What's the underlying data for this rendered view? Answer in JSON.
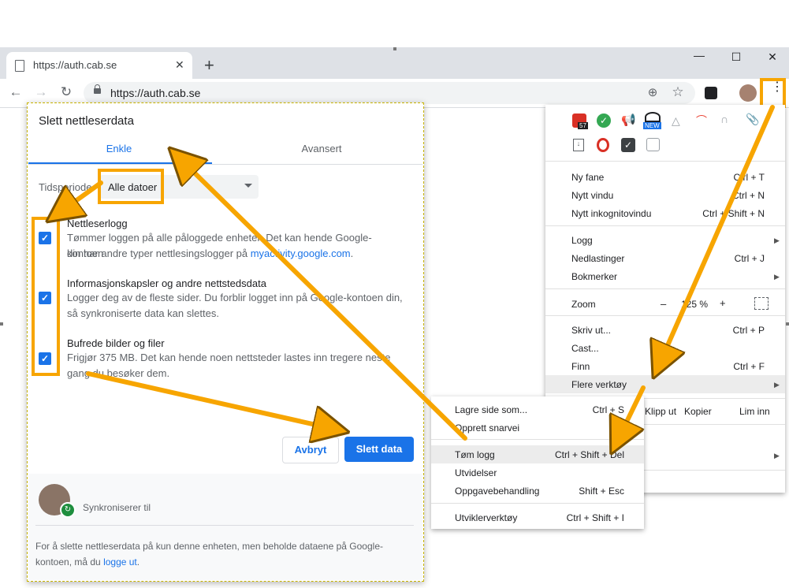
{
  "browser": {
    "tab_title": "https://auth.cab.se",
    "new_tab": "+",
    "url": "https://auth.cab.se",
    "win_min": "—",
    "win_max": "☐",
    "win_close": "✕"
  },
  "menu": {
    "ext_badge_count": "57",
    "ext_badge_new": "NEW",
    "items": [
      {
        "label": "Ny fane",
        "shortcut": "Ctrl + T"
      },
      {
        "label": "Nytt vindu",
        "shortcut": "Ctrl + N"
      },
      {
        "label": "Nytt inkognitovindu",
        "shortcut": "Ctrl + Shift + N"
      },
      {
        "label": "Logg",
        "shortcut": ""
      },
      {
        "label": "Nedlastinger",
        "shortcut": "Ctrl + J"
      },
      {
        "label": "Bokmerker",
        "shortcut": ""
      },
      {
        "label": "Zoom",
        "shortcut": ""
      },
      {
        "label": "Skriv ut...",
        "shortcut": "Ctrl + P"
      },
      {
        "label": "Cast...",
        "shortcut": ""
      },
      {
        "label": "Finn",
        "shortcut": "Ctrl + F"
      },
      {
        "label": "Flere verktøy",
        "shortcut": ""
      }
    ],
    "zoom_minus": "–",
    "zoom_value": "125 %",
    "zoom_plus": "+",
    "edit_cut": "Klipp ut",
    "edit_copy": "Kopier",
    "edit_paste": "Lim inn"
  },
  "submenu": {
    "items": [
      {
        "label": "Lagre side som...",
        "shortcut": "Ctrl + S"
      },
      {
        "label": "Opprett snarvei",
        "shortcut": ""
      },
      {
        "label": "Tøm logg",
        "shortcut": "Ctrl + Shift + Del"
      },
      {
        "label": "Utvidelser",
        "shortcut": ""
      },
      {
        "label": "Oppgavebehandling",
        "shortcut": "Shift + Esc"
      },
      {
        "label": "Utviklerverktøy",
        "shortcut": "Ctrl + Shift + I"
      }
    ]
  },
  "dialog": {
    "title": "Slett nettleserdata",
    "tab_basic": "Enkle",
    "tab_advanced": "Avansert",
    "period_label": "Tidsperiode",
    "period_value": "Alle datoer",
    "options": [
      {
        "title": "Nettleserlogg",
        "desc": "Tømmer loggen på alle påloggede enheter. Det kan hende Google-kontoen",
        "desc2": "din har andre typer nettlesingslogger på ",
        "link": "myactivity.google.com",
        "after_link": "."
      },
      {
        "title": "Informasjonskapsler og andre nettstedsdata",
        "desc": "Logger deg av de fleste sider. Du forblir logget inn på Google-kontoen din,",
        "desc2": "så synkroniserte data kan slettes."
      },
      {
        "title": "Bufrede bilder og filer",
        "desc": "Frigjør 375 MB. Det kan hende noen nettsteder lastes inn tregere neste",
        "desc2": "gang du besøker dem."
      }
    ],
    "cancel": "Avbryt",
    "confirm": "Slett data",
    "sync_text": "Synkroniserer til",
    "footer_text": "For å slette nettleserdata på kun denne enheten, men beholde dataene på Google-",
    "footer_text2": "kontoen, må du ",
    "footer_link": "logge ut",
    "footer_end": "."
  },
  "colors": {
    "accent": "#1a73e8",
    "highlight": "#f7a500"
  }
}
